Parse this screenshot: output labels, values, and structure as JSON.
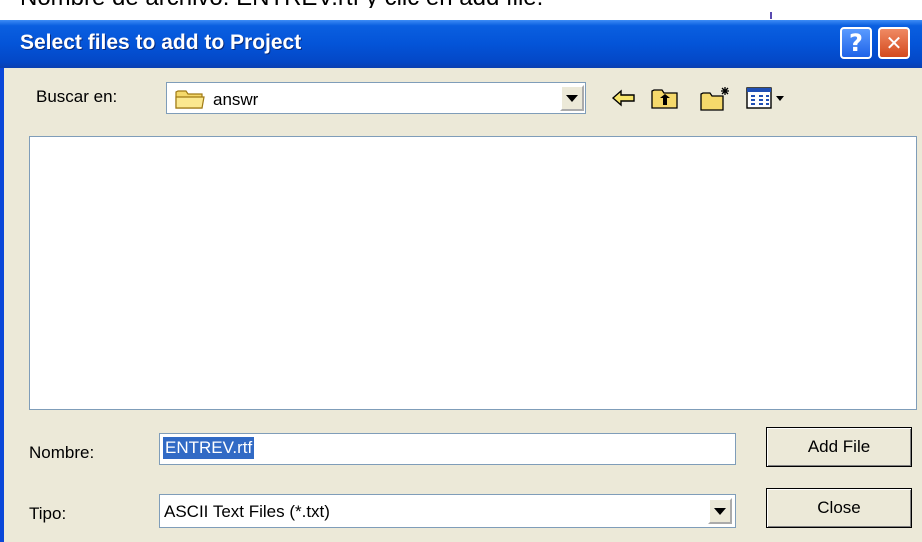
{
  "caption": "Nombre de archivo: ENTREV.rtf y clic en add file.",
  "dialog": {
    "title": "Select files to add to Project",
    "help_glyph": "?",
    "close_glyph": "✕"
  },
  "look_in": {
    "label": "Buscar en:",
    "value": "answr",
    "icon": "folder-icon"
  },
  "toolbar_icons": [
    "back-arrow-icon",
    "up-folder-icon",
    "new-folder-icon",
    "view-menu-icon"
  ],
  "file_list": [],
  "name_field": {
    "label": "Nombre:",
    "value": "ENTREV.rtf"
  },
  "type_field": {
    "label": "Tipo:",
    "value": "ASCII Text Files (*.txt)"
  },
  "buttons": {
    "add_file": "Add File",
    "close": "Close"
  },
  "colors": {
    "title_bar": "#0454d8",
    "dialog_bg": "#ece9d8",
    "selection": "#316ac5",
    "close_button": "#d34a1e",
    "help_button": "#1f63e8"
  }
}
